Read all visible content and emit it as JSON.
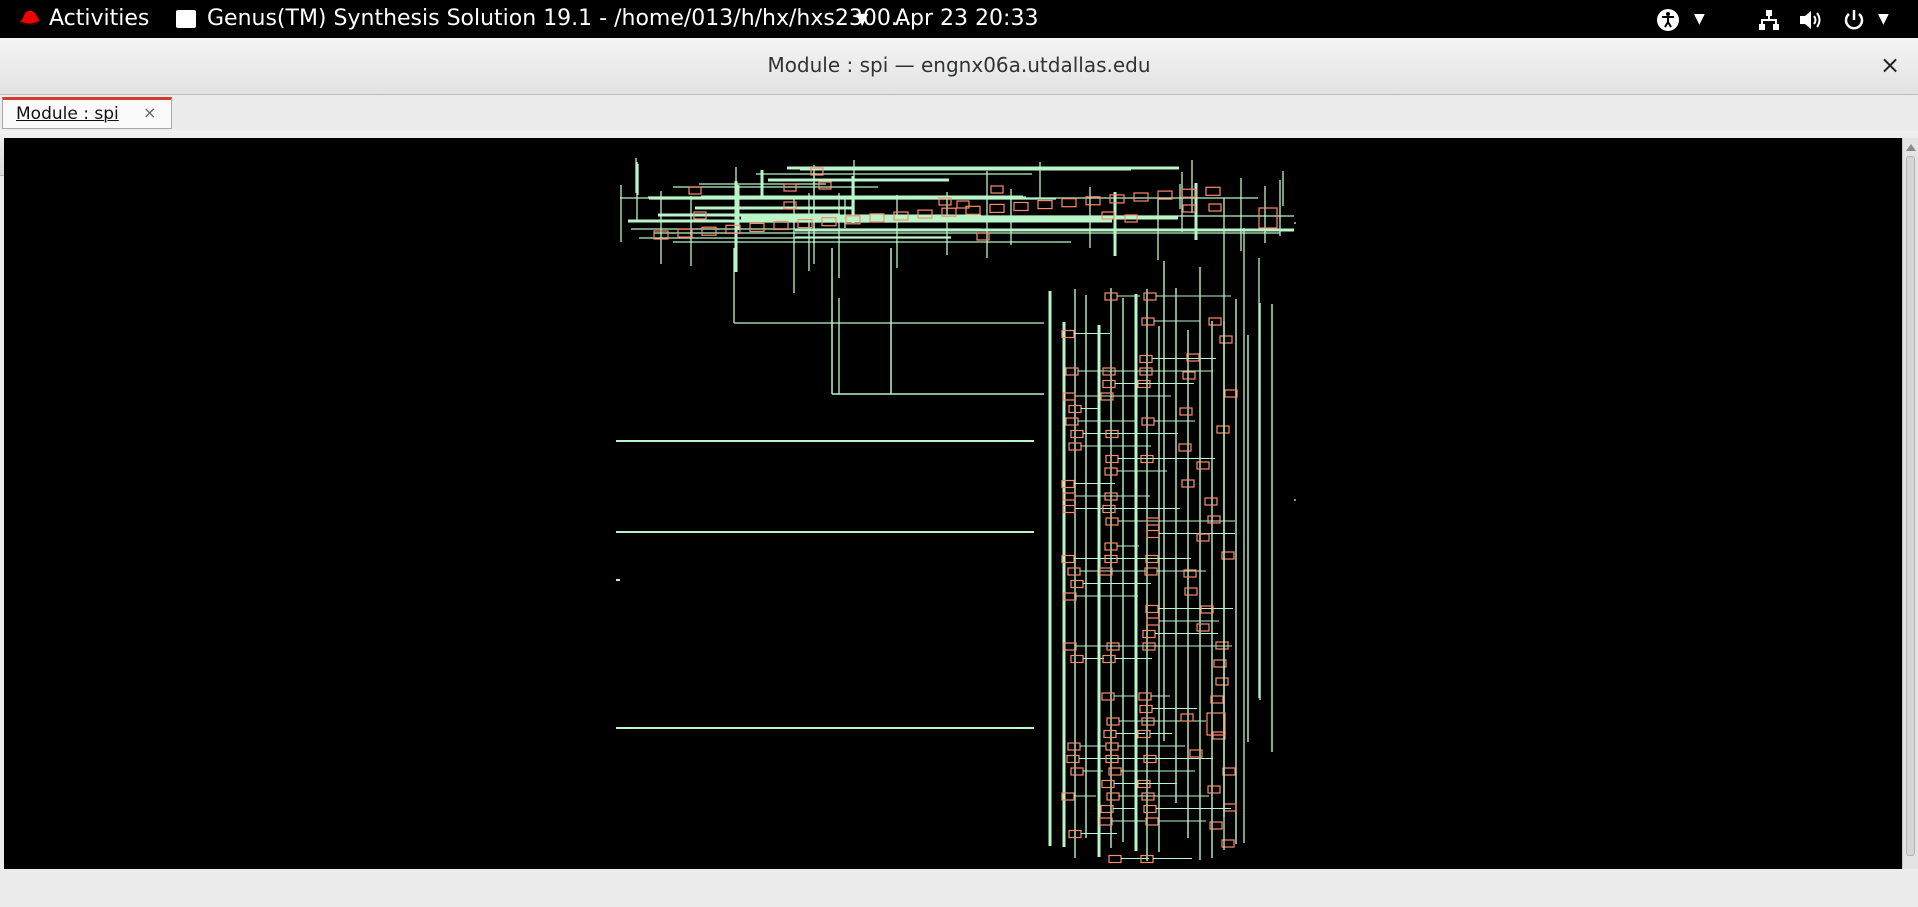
{
  "topbar": {
    "activities": "Activities",
    "app_title": "Genus(TM) Synthesis Solution 19.1 - /home/013/h/hx/hxs2300...",
    "clock": "Apr 23  20:33"
  },
  "window": {
    "title": "Module : spi — engnx06a.utdallas.edu",
    "close_glyph": "×"
  },
  "tabs": [
    {
      "label": "Module : spi",
      "close_glyph": "×"
    }
  ],
  "toolbar": {
    "icons": [
      "zoom-in-icon",
      "zoom-out-icon",
      "zoom-fit-icon",
      "zoom-previous-icon",
      "zoom-reset-icon",
      "go-to-parent-icon",
      "back-icon",
      "forward-icon",
      "hierarchy-icon",
      "select-icon",
      "settings-icon"
    ]
  },
  "colors": {
    "wire": "#b8f5c8",
    "cell": "#ff8a6a",
    "canvas_bg": "#000000",
    "tab_accent": "#d43a2f"
  },
  "schematic": {
    "module": "spi"
  }
}
